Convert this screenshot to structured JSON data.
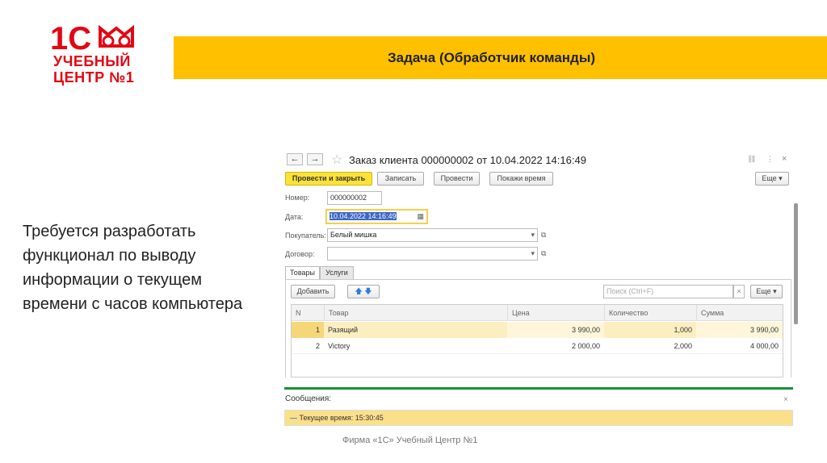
{
  "logo": {
    "brand": "1С",
    "line1": "УЧЕБНЫЙ",
    "line2": "ЦЕНТР №1",
    "color": "#e30613"
  },
  "banner": {
    "title": "Задача (Обработчик команды)",
    "color": "#ffc000"
  },
  "lead_text": "Требуется разработать функционал по выводу информации о текущем времени с часов компьютера",
  "window": {
    "title": "Заказ клиента 000000002 от 10.04.2022 14:16:49",
    "back": "←",
    "forward": "→",
    "star": "☆",
    "link": "🔗",
    "menu": "⋮",
    "close": "×",
    "toolbar": {
      "post_close": "Провести и закрыть",
      "save": "Записать",
      "post": "Провести",
      "show_time": "Покажи время",
      "more": "Еще ▾"
    },
    "fields": {
      "number_label": "Номер:",
      "number": "000000002",
      "date_label": "Дата:",
      "date": "10.04.2022 14:16:49",
      "buyer_label": "Покупатель:",
      "buyer": "Белый мишка",
      "contract_label": "Договор:",
      "contract": ""
    },
    "tabs": [
      "Товары",
      "Услуги"
    ],
    "table_toolbar": {
      "add": "Добавить",
      "search_placeholder": "Поиск (Ctrl+F)",
      "clear": "×",
      "more": "Еще ▾"
    },
    "table": {
      "columns": [
        "N",
        "Товар",
        "Цена",
        "Количество",
        "Сумма"
      ],
      "rows": [
        [
          "1",
          "Разящий",
          "3 990,00",
          "1,000",
          "3 990,00"
        ],
        [
          "2",
          "Victory",
          "2 000,00",
          "2,000",
          "4 000,00"
        ]
      ]
    },
    "messages": {
      "title": "Сообщения:",
      "close": "×",
      "items": [
        "Текущее время: 15:30:45"
      ]
    }
  },
  "footer": "Фирма «1С» Учебный Центр №1"
}
